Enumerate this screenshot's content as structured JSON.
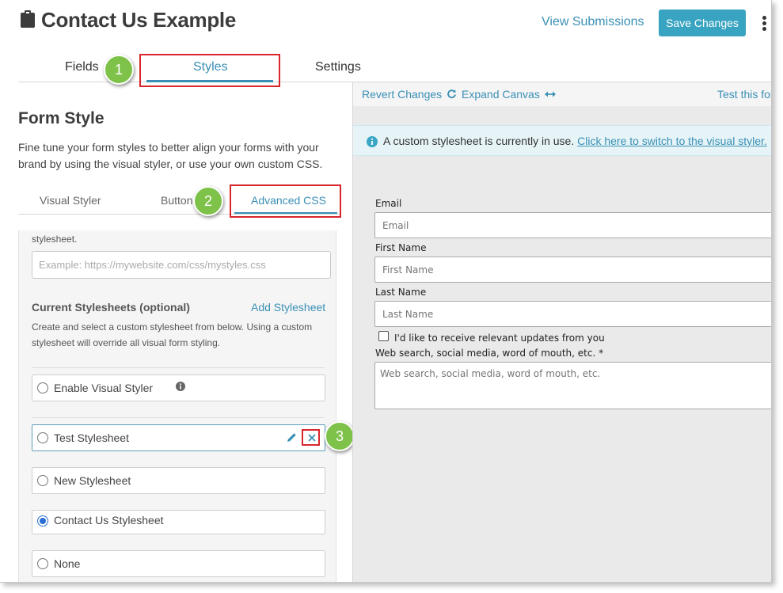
{
  "header": {
    "title": "Contact Us Example",
    "view_submissions": "View Submissions",
    "save_changes": "Save Changes"
  },
  "tabs": [
    {
      "label": "Fields",
      "active": false
    },
    {
      "label": "Styles",
      "active": true
    },
    {
      "label": "Settings",
      "active": false
    }
  ],
  "left": {
    "heading": "Form Style",
    "description": "Fine tune your form styles to better align your forms with your brand by using the visual styler, or use your own custom CSS.",
    "subtabs": [
      {
        "label": "Visual Styler",
        "active": false
      },
      {
        "label": "Button",
        "active": false
      },
      {
        "label": "Advanced CSS",
        "active": true
      }
    ],
    "stylesheet_note": "stylesheet.",
    "url_placeholder": "Example: https://mywebsite.com/css/mystyles.css",
    "current_heading": "Current Stylesheets (optional)",
    "add_stylesheet": "Add Stylesheet",
    "current_description": "Create and select a custom stylesheet from below. Using a custom stylesheet will override all visual form styling.",
    "options": [
      {
        "label": "Enable Visual Styler",
        "selected": false
      },
      {
        "label": "Test Stylesheet",
        "selected": false
      },
      {
        "label": "New Stylesheet",
        "selected": false
      },
      {
        "label": "Contact Us Stylesheet",
        "selected": true
      },
      {
        "label": "None",
        "selected": false
      }
    ]
  },
  "right": {
    "revert": "Revert Changes",
    "expand": "Expand Canvas",
    "test": "Test this form",
    "banner_text": "A custom stylesheet is currently in use.",
    "banner_link": "Click here to switch to the visual styler.",
    "form": {
      "email_label": "Email",
      "email_placeholder": "Email",
      "first_name_label": "First Name",
      "first_name_placeholder": "First Name",
      "last_name_label": "Last Name",
      "last_name_placeholder": "Last Name",
      "updates_checkbox": "I'd like to receive relevant updates from you",
      "source_label": "Web search, social media, word of mouth, etc. *",
      "source_placeholder": "Web search, social media, word of mouth, etc."
    }
  },
  "callouts": [
    "1",
    "2",
    "3"
  ],
  "colors": {
    "accent": "#3a8fb5",
    "save_button": "#39a4c1",
    "callout_badge": "#7ec24a",
    "highlight_box": "#d9262c",
    "banner_bg": "#e6f4f7"
  }
}
